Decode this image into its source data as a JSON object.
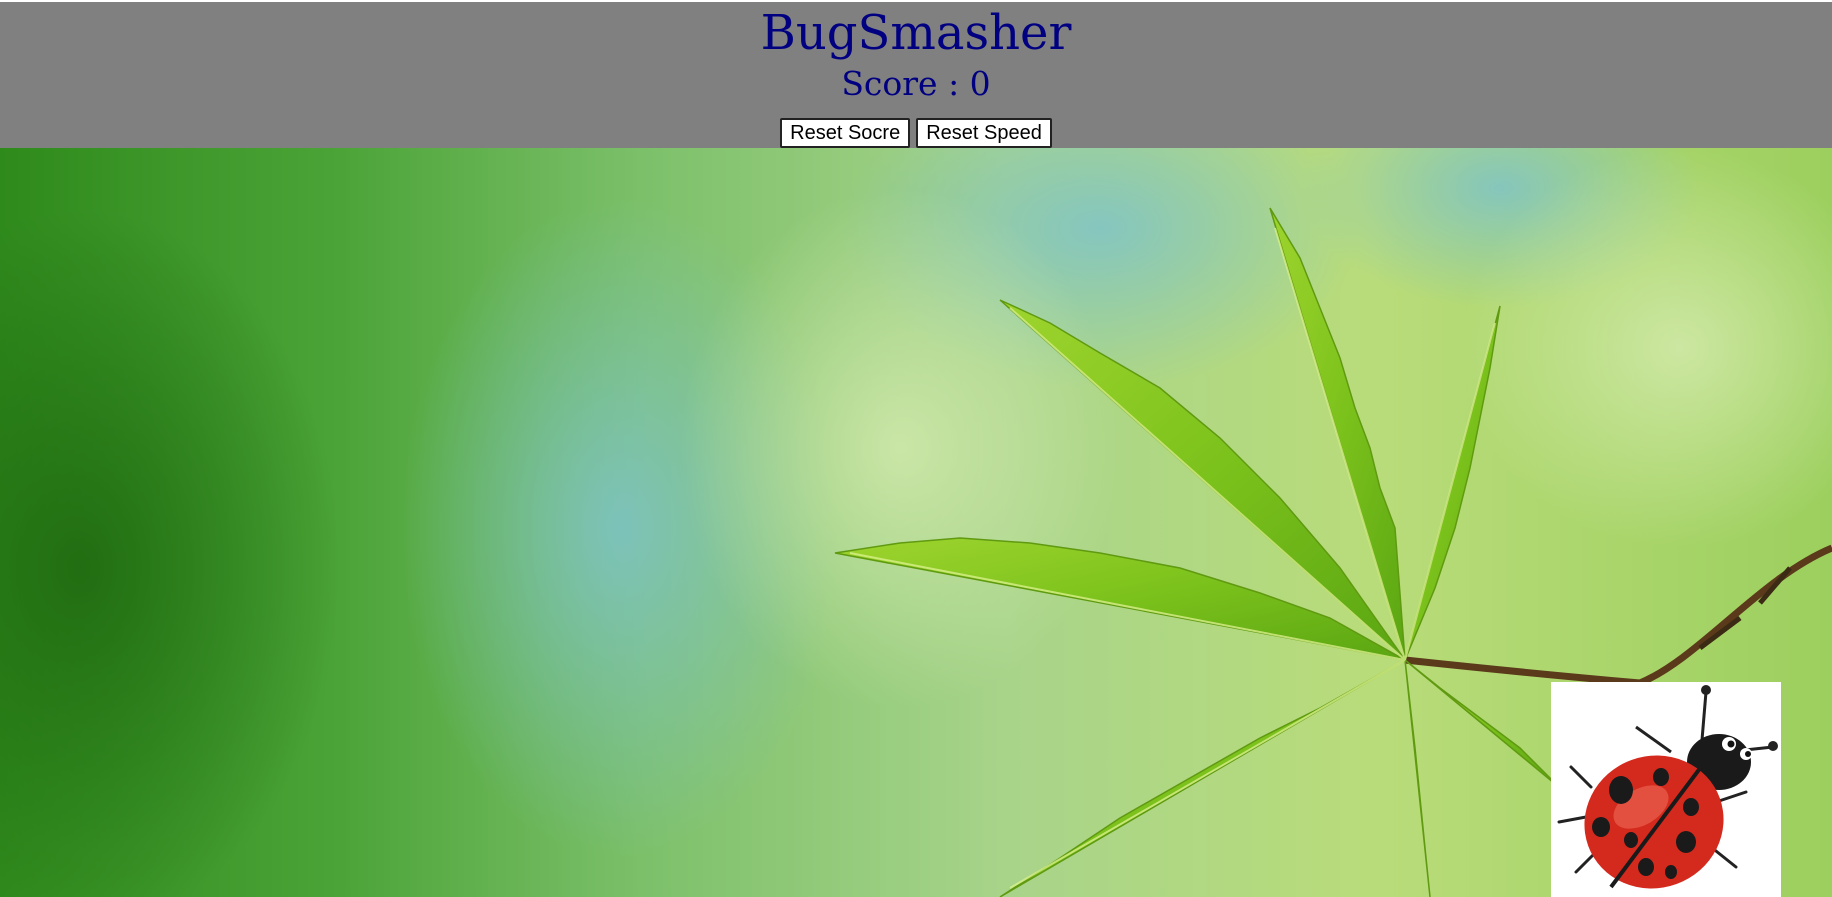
{
  "header": {
    "title": "BugSmasher",
    "score_label": "Score : ",
    "score_value": "0",
    "background_color": "#808080",
    "text_color": "#000080"
  },
  "buttons": {
    "reset_score_label": "Reset Socre",
    "reset_speed_label": "Reset Speed"
  },
  "playfield": {
    "background": "green blurred foliage with maple leaf",
    "bug_icon": "ladybug-icon"
  }
}
